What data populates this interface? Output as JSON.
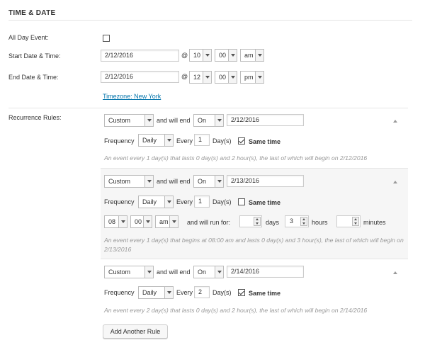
{
  "section": {
    "title": "TIME & DATE"
  },
  "all_day": {
    "label": "All Day Event:",
    "checked": false
  },
  "start": {
    "label": "Start Date & Time:",
    "date": "2/12/2016",
    "at": "@",
    "hour": "10",
    "minute": "00",
    "ampm": "am"
  },
  "end": {
    "label": "End Date & Time:",
    "date": "2/12/2016",
    "at": "@",
    "hour": "12",
    "minute": "00",
    "ampm": "pm"
  },
  "timezone": {
    "link": "Timezone: New York"
  },
  "recurrence": {
    "label": "Recurrence Rules:",
    "rules": [
      {
        "type": "Custom",
        "and_will_end": "and will end",
        "end_mode": "On",
        "end_date": "2/12/2016",
        "frequency_label": "Frequency",
        "frequency": "Daily",
        "every_label": "Every",
        "every": "1",
        "unit": "Day(s)",
        "same_time_label": "Same time",
        "same_time": true,
        "summary": "An event every 1 day(s) that lasts 0 day(s) and 2 hour(s), the last of which will begin on 2/12/2016"
      },
      {
        "type": "Custom",
        "and_will_end": "and will end",
        "end_mode": "On",
        "end_date": "2/13/2016",
        "frequency_label": "Frequency",
        "frequency": "Daily",
        "every_label": "Every",
        "every": "1",
        "unit": "Day(s)",
        "same_time_label": "Same time",
        "same_time": false,
        "start_hour": "08",
        "start_minute": "00",
        "start_ampm": "am",
        "will_run_for": "and will run for:",
        "days": "",
        "days_label": "days",
        "hours": "3",
        "hours_label": "hours",
        "minutes": "",
        "minutes_label": "minutes",
        "summary": "An event every 1 day(s) that begins at 08:00 am and lasts 0 day(s) and 3 hour(s), the last of which will begin on 2/13/2016"
      },
      {
        "type": "Custom",
        "and_will_end": "and will end",
        "end_mode": "On",
        "end_date": "2/14/2016",
        "frequency_label": "Frequency",
        "frequency": "Daily",
        "every_label": "Every",
        "every": "2",
        "unit": "Day(s)",
        "same_time_label": "Same time",
        "same_time": true,
        "summary": "An event every 2 day(s) that lasts 0 day(s) and 2 hour(s), the last of which will begin on 2/14/2016"
      }
    ],
    "add_button": "Add Another Rule"
  },
  "icons": {
    "collapse": "collapse-arrow-icon",
    "dropdown": "chevron-down-icon",
    "spinner": "spinner-arrows-icon",
    "check": "checkmark-icon"
  }
}
